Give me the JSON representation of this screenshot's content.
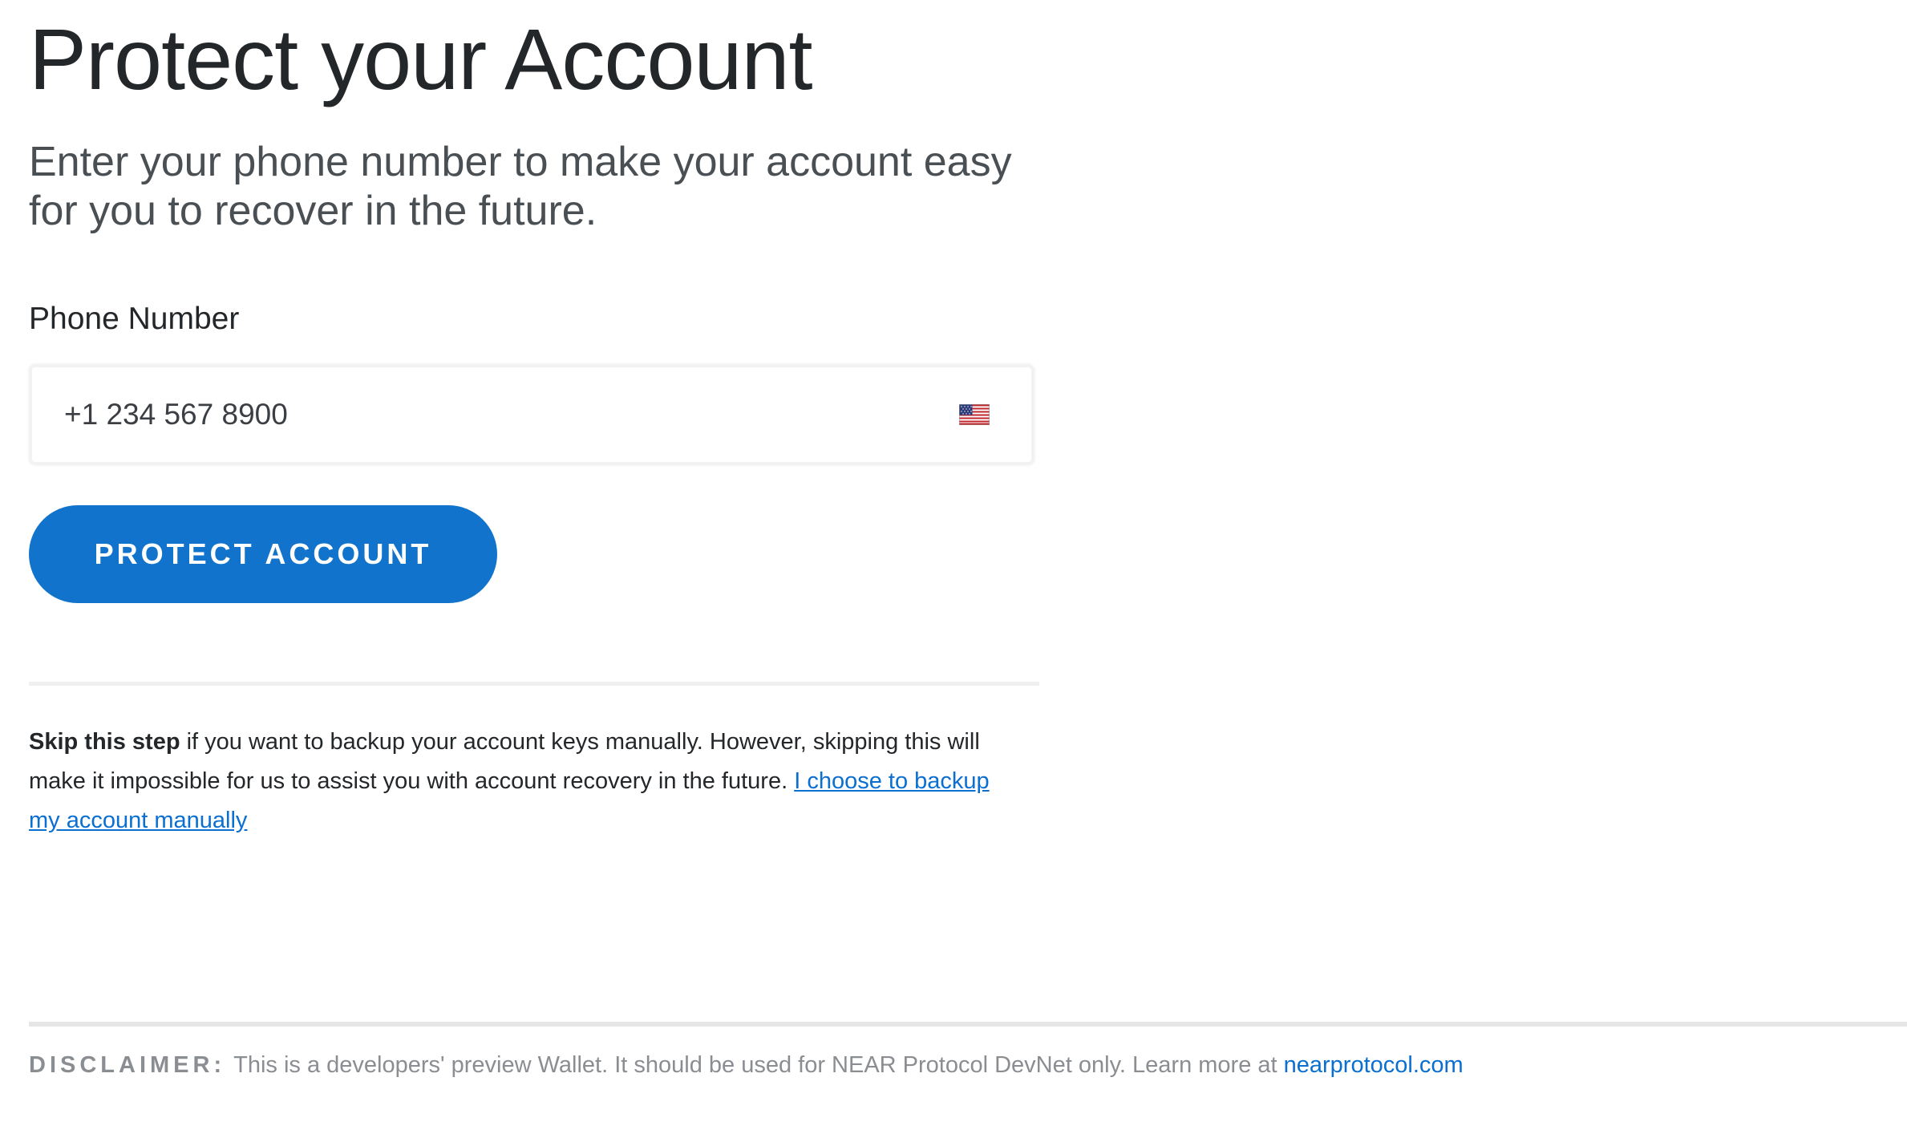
{
  "page": {
    "title": "Protect your Account",
    "subtitle": "Enter your phone number to make your account easy for you to recover in the future."
  },
  "form": {
    "phone_label": "Phone Number",
    "phone_placeholder": "+1 234 567 8900",
    "phone_value": "",
    "country_flag_icon": "us-flag-icon",
    "submit_label": "PROTECT ACCOUNT"
  },
  "skip": {
    "bold": "Skip this step",
    "text": " if you want to backup your account keys manually. However, skipping this will make it impossible for us to assist you with account recovery in the future. ",
    "link_label": "I choose to backup my account manually"
  },
  "footer": {
    "disclaimer_label": "DISCLAIMER:",
    "disclaimer_text": "This is a developers' preview Wallet. It should be used for NEAR Protocol DevNet only. Learn more at ",
    "disclaimer_link": "nearprotocol.com"
  },
  "colors": {
    "primary_button": "#1273cc",
    "link": "#0a6fd1",
    "title_text": "#24272a",
    "muted_text": "#8a8d91"
  }
}
